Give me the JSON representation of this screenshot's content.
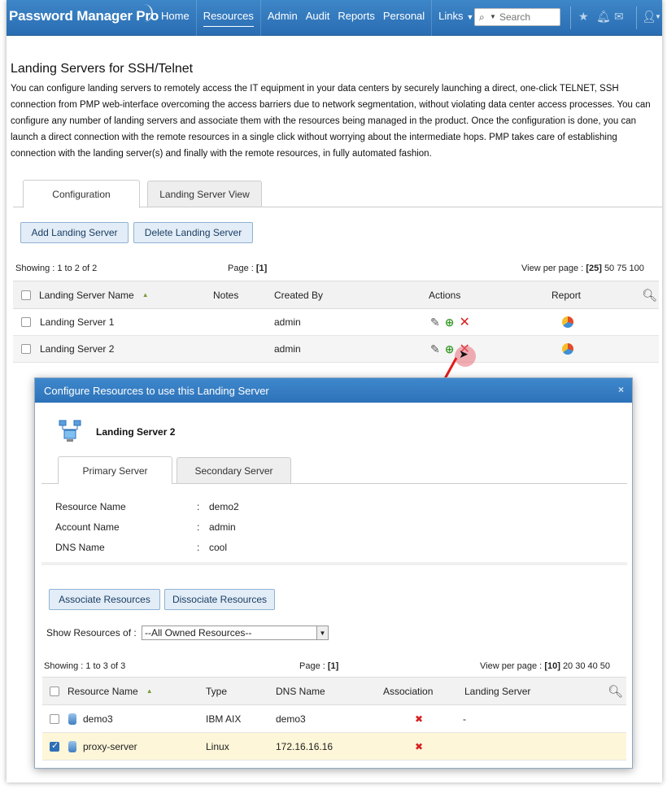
{
  "app": {
    "brand": "Password Manager Pro",
    "nav": [
      {
        "label": "Home"
      },
      {
        "label": "Resources"
      },
      {
        "label": "Admin"
      },
      {
        "label": "Audit"
      },
      {
        "label": "Reports"
      },
      {
        "label": "Personal"
      },
      {
        "label": "Links"
      }
    ],
    "search_placeholder": "Search"
  },
  "page": {
    "title": "Landing Servers for SSH/Telnet",
    "intro": "You can configure landing servers to remotely access the IT equipment in your data centers by securely launching a direct, one-click TELNET, SSH connection from PMP web-interface overcoming the access barriers due to network segmentation, without violating data center access processes. You can configure any number of landing servers and associate them with the resources being managed in the product. Once the configuration is done, you can launch a direct connection with the remote resources in a single click without worrying about the intermediate hops. PMP takes care of establishing connection with the landing server(s) and finally with the remote resources, in fully automated fashion.",
    "tabs": [
      {
        "label": "Configuration",
        "active": true
      },
      {
        "label": "Landing Server View",
        "active": false
      }
    ],
    "buttons": {
      "add": "Add Landing Server",
      "delete": "Delete Landing Server"
    },
    "showing": "Showing : 1 to 2 of 2",
    "page_label": "Page :",
    "page_value": "[1]",
    "view_per_page_label": "View per page :",
    "view_per_page_current": "[25]",
    "view_per_page_options": "50 75 100",
    "table": {
      "columns": {
        "name": "Landing Server Name",
        "notes": "Notes",
        "created_by": "Created By",
        "actions": "Actions",
        "report": "Report"
      },
      "rows": [
        {
          "name": "Landing Server 1",
          "notes": "",
          "created_by": "admin"
        },
        {
          "name": "Landing Server 2",
          "notes": "",
          "created_by": "admin"
        }
      ]
    }
  },
  "dialog": {
    "title": "Configure Resources to use this Landing Server",
    "close": "×",
    "server_name": "Landing Server 2",
    "tabs": [
      {
        "label": "Primary Server",
        "active": true
      },
      {
        "label": "Secondary Server",
        "active": false
      }
    ],
    "details": [
      {
        "key": "Resource Name",
        "value": "demo2"
      },
      {
        "key": "Account Name",
        "value": "admin"
      },
      {
        "key": "DNS Name",
        "value": "cool"
      }
    ],
    "separator": ":",
    "buttons": {
      "associate": "Associate Resources",
      "dissociate": "Dissociate Resources"
    },
    "filter_label": "Show Resources of :",
    "filter_value": "--All Owned Resources--",
    "showing": "Showing : 1 to 3 of 3",
    "page_label": "Page :",
    "page_value": "[1]",
    "view_per_page_label": "View per page :",
    "view_per_page_current": "[10]",
    "view_per_page_options": "20 30 40 50",
    "table": {
      "columns": {
        "name": "Resource Name",
        "type": "Type",
        "dns": "DNS Name",
        "association": "Association",
        "landing": "Landing Server"
      },
      "rows": [
        {
          "name": "demo3",
          "type": "IBM AIX",
          "dns": "demo3",
          "association": "x",
          "landing": "-",
          "checked": false
        },
        {
          "name": "proxy-server",
          "type": "Linux",
          "dns": "172.16.16.16",
          "association": "x",
          "landing": "",
          "checked": true
        }
      ]
    }
  },
  "colors": {
    "header_blue": "#2d72b9",
    "selected_row": "#fdf6d8",
    "button_bg": "#e3edf7",
    "delete_red": "#d82020"
  },
  "icons": [
    "search-icon",
    "star-icon",
    "bell-icon",
    "mail-icon",
    "user-icon",
    "edit-icon",
    "add-resource-icon",
    "delete-icon",
    "report-icon",
    "server-icon",
    "resource-icon",
    "close-icon",
    "cursor-icon"
  ]
}
